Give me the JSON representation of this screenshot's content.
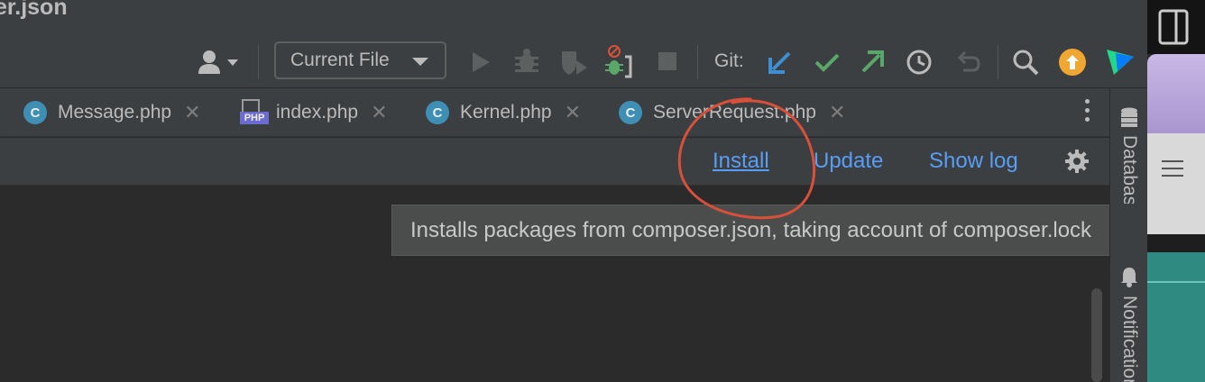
{
  "window": {
    "title": "er.json"
  },
  "toolbar": {
    "run_config": "Current File",
    "git_label": "Git:"
  },
  "tabs": [
    {
      "label": "Message.php",
      "icon": "class-icon"
    },
    {
      "label": "index.php",
      "icon": "php-file-icon"
    },
    {
      "label": "Kernel.php",
      "icon": "class-icon"
    },
    {
      "label": "ServerRequest.php",
      "icon": "class-icon"
    }
  ],
  "icon_letters": {
    "class": "C",
    "php": "PHP"
  },
  "composer_bar": {
    "install": "Install",
    "update": "Update",
    "show_log": "Show log"
  },
  "tooltip": {
    "text": "Installs packages from composer.json, taking account of composer.lock"
  },
  "right_strip": {
    "database": "Database",
    "notifications": "Notifications"
  },
  "colors": {
    "link": "#589df6",
    "git_update": "#3d8fd1",
    "git_commit": "#59a869",
    "git_push": "#59a869",
    "update_badge": "#f0a732",
    "annotation": "#d9503a"
  }
}
